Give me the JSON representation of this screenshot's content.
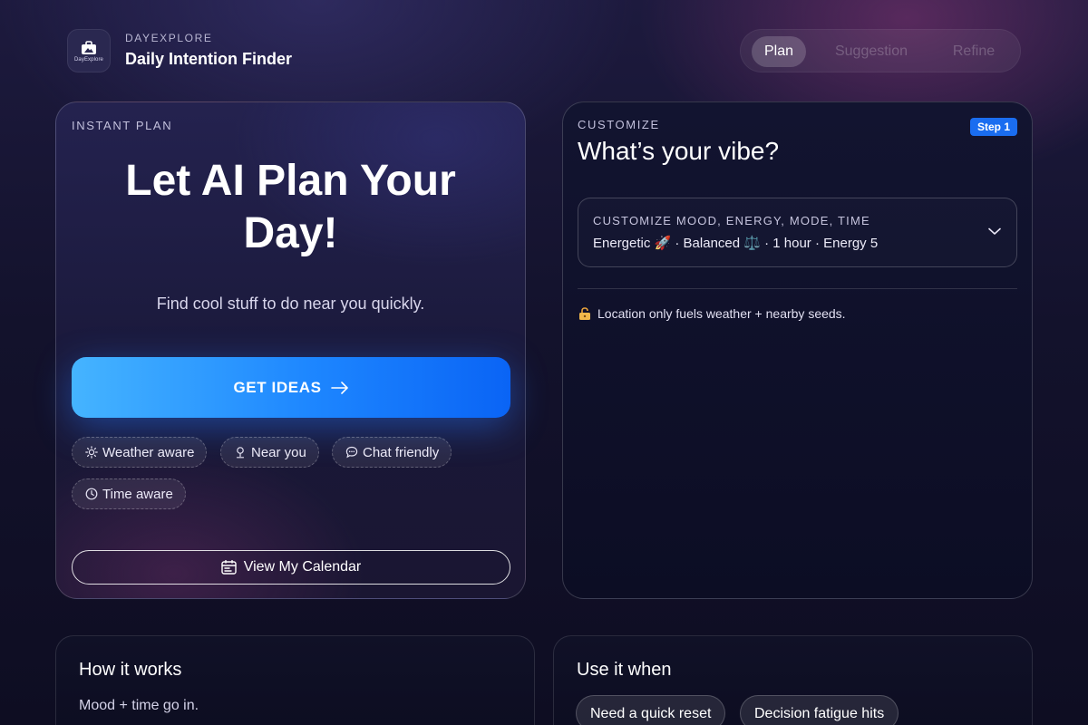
{
  "header": {
    "logo_text": "DayExplore",
    "eyebrow": "DAYEXPLORE",
    "title": "Daily Intention Finder"
  },
  "tabs": [
    {
      "label": "Plan",
      "active": true
    },
    {
      "label": "Suggestion",
      "active": false
    },
    {
      "label": "Refine",
      "active": false
    }
  ],
  "instant_plan": {
    "eyebrow": "INSTANT PLAN",
    "title_line1": "Let AI Plan Your",
    "title_line2": "Day!",
    "subtitle": "Find cool stuff to do near you quickly.",
    "cta_label": "GET IDEAS",
    "chips": [
      {
        "label": "Weather aware",
        "icon": "sun-icon"
      },
      {
        "label": "Near you",
        "icon": "location-pin-icon"
      },
      {
        "label": "Chat friendly",
        "icon": "chat-bubble-icon"
      },
      {
        "label": "Time aware",
        "icon": "clock-icon"
      }
    ],
    "calendar_label": "View My Calendar"
  },
  "customize": {
    "eyebrow": "CUSTOMIZE",
    "step_badge": "Step 1",
    "title": "What’s your vibe?",
    "dropdown_label": "CUSTOMIZE MOOD, ENERGY, MODE, TIME",
    "dropdown_value": "Energetic 🚀 · Balanced ⚖️ · 1 hour · Energy 5",
    "location_note": "Location only fuels weather + nearby seeds."
  },
  "how_it_works": {
    "title": "How it works",
    "text": "Mood + time go in."
  },
  "use_it_when": {
    "title": "Use it when",
    "pills": [
      "Need a quick reset",
      "Decision fatigue hits"
    ]
  },
  "colors": {
    "accent_blue": "#1a6df0",
    "cta_gradient_start": "#45b4ff",
    "cta_gradient_end": "#0a64f5",
    "background": "#13122c"
  }
}
